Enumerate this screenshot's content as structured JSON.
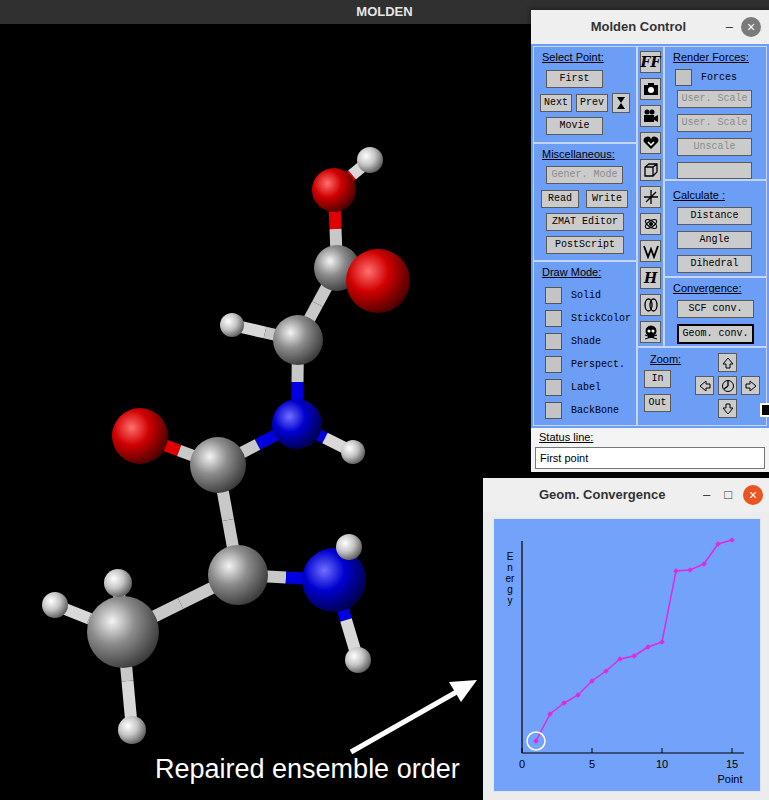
{
  "window": {
    "title": "MOLDEN"
  },
  "control": {
    "title": "Molden Control",
    "title_buttons": [
      "–",
      "×"
    ],
    "select_point": {
      "label": "Select Point:",
      "first": "First",
      "next": "Next",
      "prev": "Prev",
      "movie": "Movie"
    },
    "miscellaneous": {
      "label": "Miscellaneous:",
      "buttons": [
        {
          "label": "Gener. Mode",
          "disabled": true
        },
        {
          "label": "Read",
          "disabled": false
        },
        {
          "label": "Write",
          "disabled": false
        },
        {
          "label": "ZMAT Editor",
          "disabled": false
        },
        {
          "label": "PostScript",
          "disabled": false
        }
      ]
    },
    "draw_mode": {
      "label": "Draw Mode:",
      "options": [
        {
          "label": "Solid",
          "checked": false
        },
        {
          "label": "StickColor",
          "checked": false
        },
        {
          "label": "Shade",
          "checked": false
        },
        {
          "label": "Perspect.",
          "checked": false
        },
        {
          "label": "Label",
          "checked": false
        },
        {
          "label": "BackBone",
          "checked": false
        }
      ]
    },
    "tools": [
      {
        "kind": "text",
        "label": "FF"
      },
      {
        "kind": "icon"
      },
      {
        "kind": "icon"
      },
      {
        "kind": "icon"
      },
      {
        "kind": "icon"
      },
      {
        "kind": "icon"
      },
      {
        "kind": "icon"
      },
      {
        "kind": "icon"
      },
      {
        "kind": "text",
        "label": "H"
      },
      {
        "kind": "icon"
      },
      {
        "kind": "icon"
      }
    ],
    "render_forces": {
      "label": "Render Forces:",
      "forces": {
        "label": "Forces",
        "checked": false
      },
      "buttons": [
        {
          "label": "User. Scale",
          "disabled": true
        },
        {
          "label": "User. Scale",
          "disabled": true
        },
        {
          "label": "Unscale",
          "disabled": true
        },
        {
          "label": "",
          "disabled": false
        }
      ]
    },
    "calculate": {
      "label": "Calculate :",
      "buttons": [
        "Distance",
        "Angle",
        "Dihedral"
      ]
    },
    "convergence": {
      "label": "Convergence:",
      "buttons": [
        {
          "label": "SCF conv.",
          "selected": false
        },
        {
          "label": "Geom. conv.",
          "selected": true
        }
      ]
    },
    "zoom": {
      "label": "Zoom:",
      "in": "In",
      "out": "Out",
      "toggle": {
        "checked": true
      }
    },
    "status": {
      "label": "Status line:",
      "text": "First point"
    }
  },
  "convergence_window": {
    "title": "Geom. Convergence",
    "title_buttons": [
      "–",
      "□",
      "×"
    ],
    "y_label": "Energy",
    "x_label": "Point",
    "x_ticks": [
      "0",
      "5",
      "10",
      "15"
    ],
    "series": [
      {
        "name": "energy",
        "values": [
          12,
          39,
          50,
          58,
          72,
          82,
          94,
          97,
          106,
          111,
          182,
          183,
          189,
          209,
          213
        ]
      }
    ],
    "selected_point": 1
  },
  "caption": "Repaired ensemble order"
}
